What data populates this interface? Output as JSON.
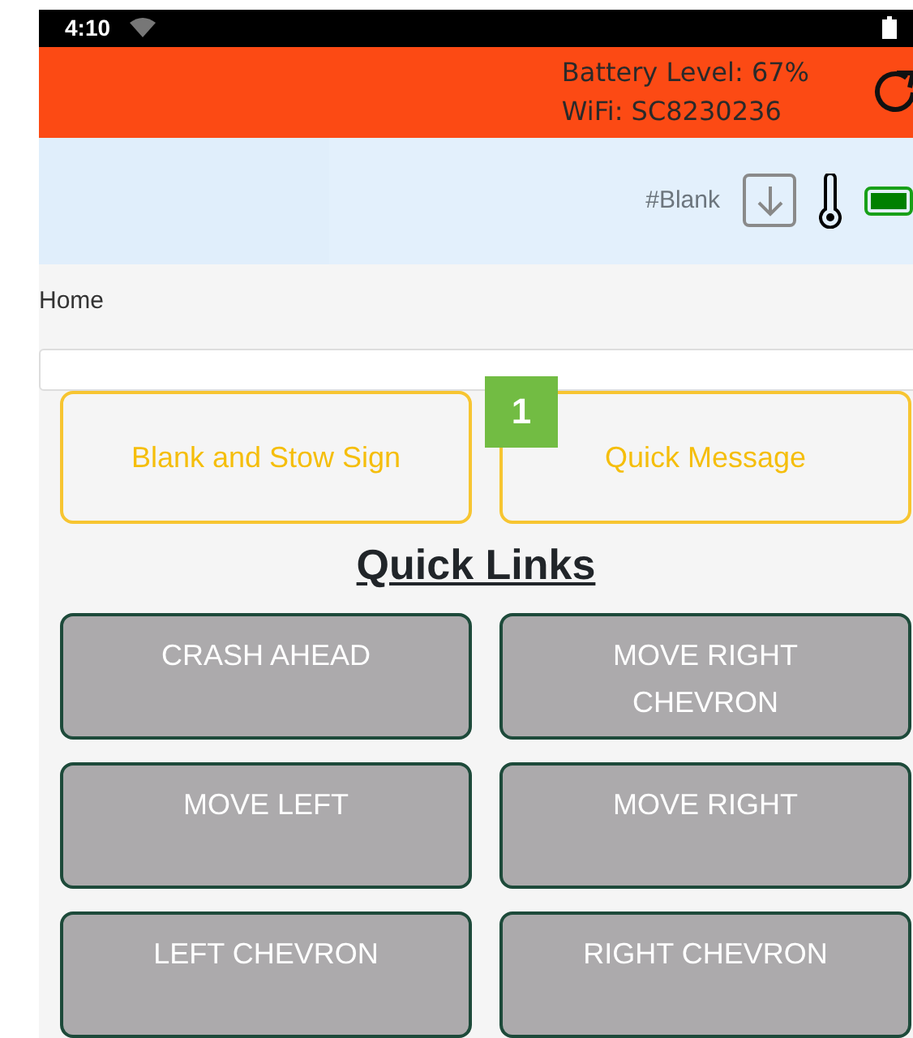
{
  "status_bar": {
    "time": "4:10"
  },
  "header": {
    "battery_text": "Battery Level: 67%",
    "wifi_text": "WiFi: SC8230236"
  },
  "toolbar": {
    "sign_label": "#Blank"
  },
  "breadcrumb": "Home",
  "actions": [
    {
      "label": "Blank and Stow Sign"
    },
    {
      "label": "Quick Message"
    }
  ],
  "badge": "1",
  "quick_links_title": "Quick Links",
  "quick_links": [
    {
      "label": "CRASH AHEAD"
    },
    {
      "label": "MOVE RIGHT CHEVRON"
    },
    {
      "label": "MOVE LEFT"
    },
    {
      "label": "MOVE RIGHT"
    },
    {
      "label": "LEFT CHEVRON"
    },
    {
      "label": "RIGHT CHEVRON"
    }
  ]
}
